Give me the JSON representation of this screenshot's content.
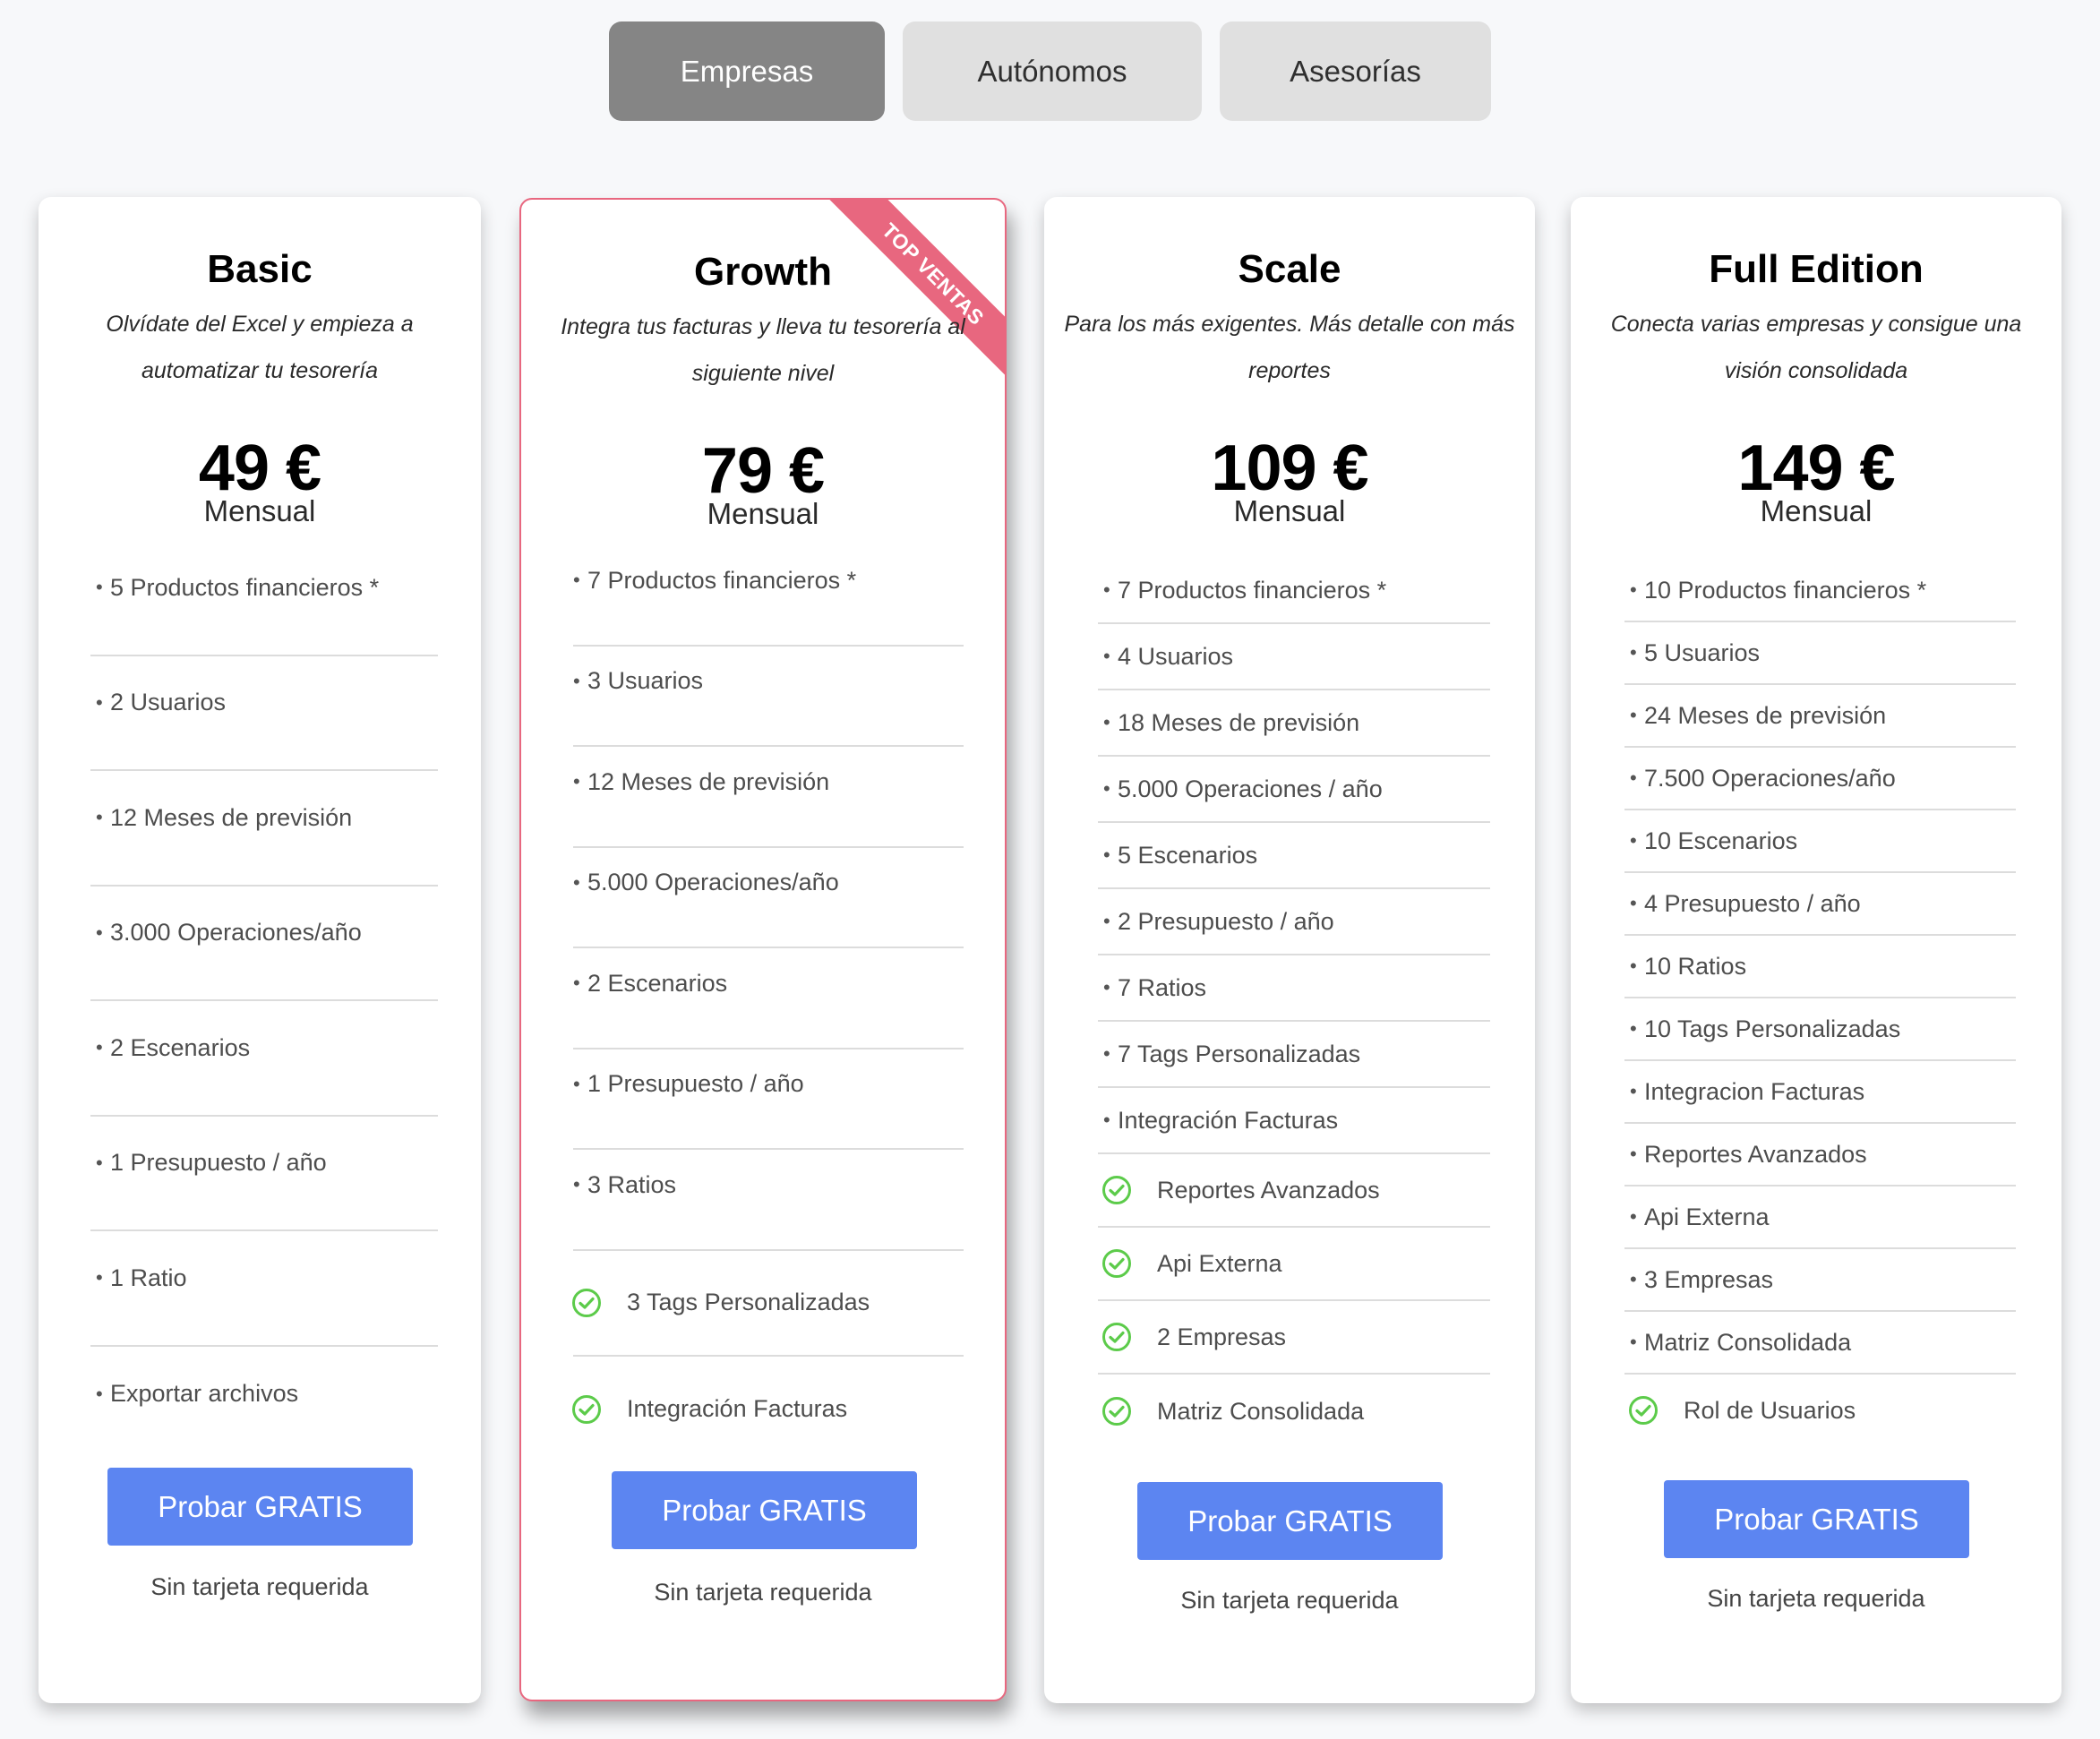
{
  "tabs": [
    {
      "label": "Empresas",
      "active": true
    },
    {
      "label": "Autónomos",
      "active": false
    },
    {
      "label": "Asesorías",
      "active": false
    }
  ],
  "colors": {
    "tab_active_bg": "#858585",
    "tab_inactive_bg": "#e0e0e0",
    "cta_bg": "#5c85f1",
    "highlight_border": "#e8677f",
    "check_green": "#5ccb4a"
  },
  "plans": [
    {
      "name": "Basic",
      "description": "Olvídate del Excel y empieza a automatizar tu tesorería",
      "price": "49 €",
      "period": "Mensual",
      "features": [
        {
          "text": "5 Productos financieros *",
          "icon": "bullet"
        },
        {
          "text": "2 Usuarios",
          "icon": "bullet"
        },
        {
          "text": "12 Meses de previsión",
          "icon": "bullet"
        },
        {
          "text": "3.000 Operaciones/año",
          "icon": "bullet"
        },
        {
          "text": "2 Escenarios",
          "icon": "bullet"
        },
        {
          "text": "1 Presupuesto / año",
          "icon": "bullet"
        },
        {
          "text": "1 Ratio",
          "icon": "bullet"
        },
        {
          "text": "Exportar archivos",
          "icon": "bullet"
        }
      ],
      "cta": "Probar GRATIS",
      "note": "Sin tarjeta requerida"
    },
    {
      "name": "Growth",
      "description": "Integra tus facturas y lleva tu tesorería al siguiente nivel",
      "ribbon": "TOP VENTAS",
      "price": "79 €",
      "period": "Mensual",
      "features": [
        {
          "text": "7 Productos financieros *",
          "icon": "bullet"
        },
        {
          "text": "3 Usuarios",
          "icon": "bullet"
        },
        {
          "text": "12 Meses de previsión",
          "icon": "bullet"
        },
        {
          "text": "5.000 Operaciones/año",
          "icon": "bullet"
        },
        {
          "text": "2 Escenarios",
          "icon": "bullet"
        },
        {
          "text": "1 Presupuesto / año",
          "icon": "bullet"
        },
        {
          "text": "3 Ratios",
          "icon": "bullet"
        },
        {
          "text": "3 Tags Personalizadas",
          "icon": "check-circle"
        },
        {
          "text": "Integración Facturas",
          "icon": "check-circle"
        }
      ],
      "cta": "Probar GRATIS",
      "note": "Sin tarjeta requerida"
    },
    {
      "name": "Scale",
      "description": "Para los más exigentes. Más detalle con más reportes",
      "price": "109 €",
      "period": "Mensual",
      "features": [
        {
          "text": "7 Productos financieros *",
          "icon": "bullet"
        },
        {
          "text": "4 Usuarios",
          "icon": "bullet"
        },
        {
          "text": "18 Meses de previsión",
          "icon": "bullet"
        },
        {
          "text": "5.000 Operaciones / año",
          "icon": "bullet"
        },
        {
          "text": "5 Escenarios",
          "icon": "bullet"
        },
        {
          "text": "2 Presupuesto / año",
          "icon": "bullet"
        },
        {
          "text": "7 Ratios",
          "icon": "bullet"
        },
        {
          "text": "7 Tags Personalizadas",
          "icon": "bullet"
        },
        {
          "text": "Integración Facturas",
          "icon": "bullet"
        },
        {
          "text": "Reportes Avanzados",
          "icon": "check-circle"
        },
        {
          "text": "Api Externa",
          "icon": "check-circle"
        },
        {
          "text": "2 Empresas",
          "icon": "check-circle"
        },
        {
          "text": "Matriz Consolidada",
          "icon": "check-circle"
        }
      ],
      "cta": "Probar GRATIS",
      "note": "Sin tarjeta requerida"
    },
    {
      "name": "Full Edition",
      "description": "Conecta varias empresas y consigue una visión consolidada",
      "price": "149 €",
      "period": "Mensual",
      "features": [
        {
          "text": "10 Productos financieros *",
          "icon": "bullet"
        },
        {
          "text": "5 Usuarios",
          "icon": "bullet"
        },
        {
          "text": "24 Meses de previsión",
          "icon": "bullet"
        },
        {
          "text": "7.500 Operaciones/año",
          "icon": "bullet"
        },
        {
          "text": "10 Escenarios",
          "icon": "bullet"
        },
        {
          "text": "4 Presupuesto / año",
          "icon": "bullet"
        },
        {
          "text": "10 Ratios",
          "icon": "bullet"
        },
        {
          "text": "10 Tags Personalizadas",
          "icon": "bullet"
        },
        {
          "text": "Integracion Facturas",
          "icon": "bullet"
        },
        {
          "text": "Reportes Avanzados",
          "icon": "bullet"
        },
        {
          "text": "Api Externa",
          "icon": "bullet"
        },
        {
          "text": "3 Empresas",
          "icon": "bullet"
        },
        {
          "text": "Matriz Consolidada",
          "icon": "bullet"
        },
        {
          "text": "Rol de Usuarios",
          "icon": "check-circle"
        }
      ],
      "cta": "Probar GRATIS",
      "note": "Sin tarjeta requerida"
    }
  ]
}
